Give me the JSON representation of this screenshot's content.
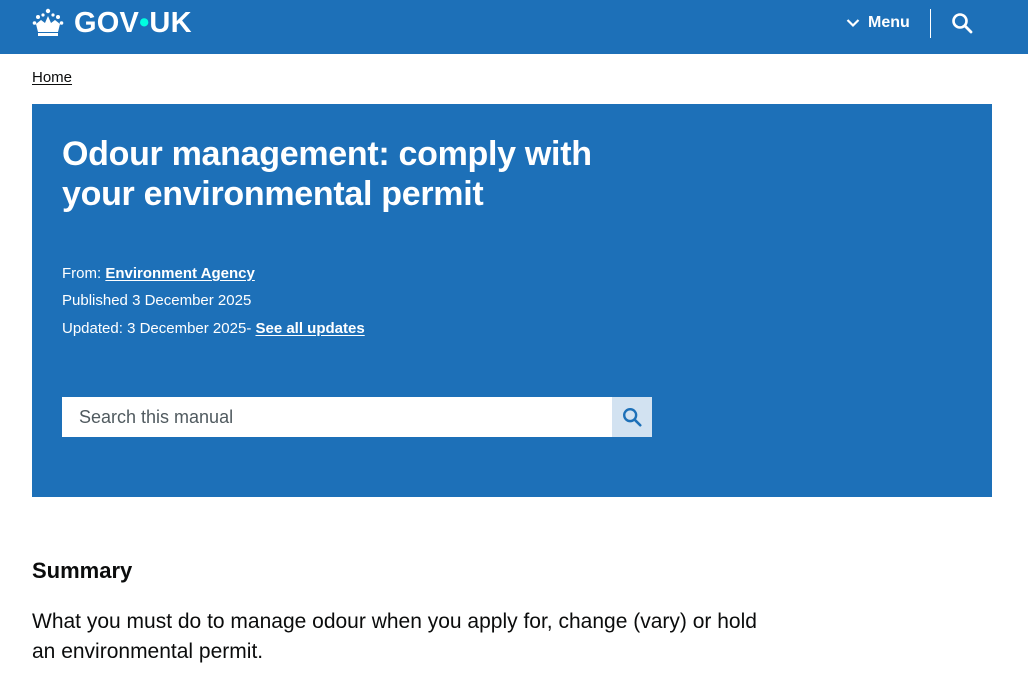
{
  "header": {
    "logo_text_left": "GOV",
    "logo_dot": "•",
    "logo_text_right": "UK",
    "menu_label": "Menu",
    "brand_color": "#1d70b8",
    "logo_dot_color": "#00ffe0"
  },
  "breadcrumb": {
    "home": "Home"
  },
  "hero": {
    "title": "Odour management: comply with your environmental permit",
    "from_label": "From:",
    "from_org": "Environment Agency",
    "published_label": "Published",
    "published_date": "3 December 2025",
    "updated_label": "Updated:",
    "updated_date": "3 December 2025",
    "updated_separator": "-",
    "see_all_updates": "See all updates",
    "search_placeholder": "Search this manual",
    "search_button_bg": "#d2e2f1"
  },
  "summary": {
    "heading": "Summary",
    "text": "What you must do to manage odour when you apply for, change (vary) or hold an environmental permit."
  }
}
